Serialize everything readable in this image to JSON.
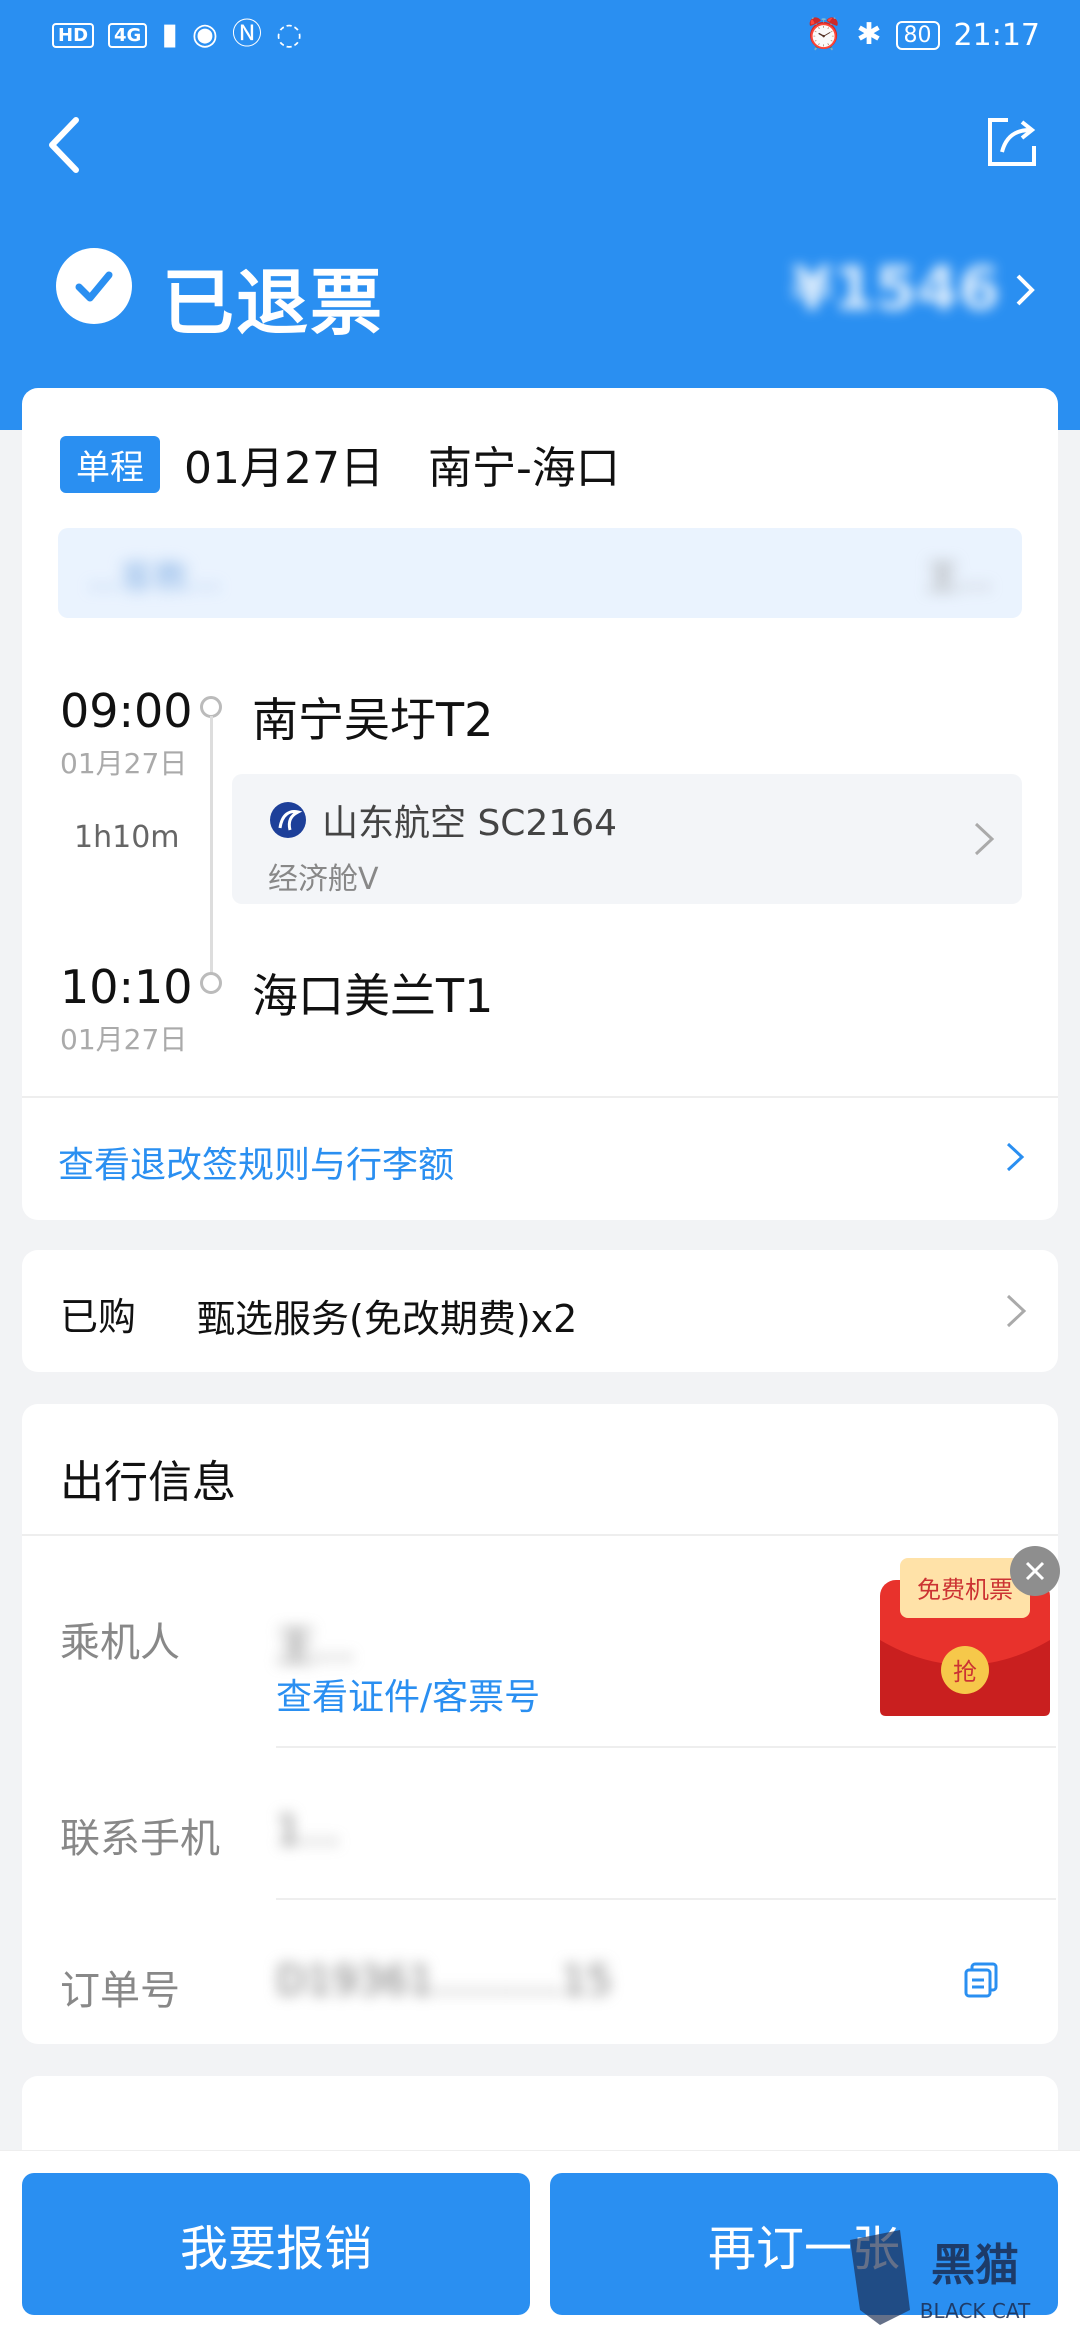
{
  "status_bar": {
    "left_chips": [
      "HD",
      "4G"
    ],
    "right_battery": "80",
    "time": "21:17"
  },
  "header": {
    "status_title": "已退票",
    "price": "¥1546"
  },
  "flight": {
    "tag": "单程",
    "date": "01月27日",
    "route": "南宁-海口",
    "agency_left": "...客教...",
    "agency_right": "王...",
    "depart_time": "09:00",
    "depart_date": "01月27日",
    "depart_airport": "南宁吴圩T2",
    "duration": "1h10m",
    "airline": "山东航空 SC2164",
    "cabin": "经济舱V",
    "arrive_time": "10:10",
    "arrive_date": "01月27日",
    "arrive_airport": "海口美兰T1",
    "rules_link": "查看退改签规则与行李额"
  },
  "service": {
    "label": "已购",
    "text": "甄选服务(免改期费)x2"
  },
  "travel_info": {
    "title": "出行信息",
    "passenger_label": "乘机人",
    "passenger_value": "王...",
    "passenger_link": "查看证件/客票号",
    "phone_label": "联系手机",
    "phone_value": "1...",
    "order_label": "订单号",
    "order_value": "D19361..........15"
  },
  "promo": {
    "text": "免费机票",
    "grab": "抢"
  },
  "buttons": {
    "reimburse": "我要报销",
    "rebook": "再订一张"
  },
  "watermark": {
    "text": "黑猫",
    "sub": "BLACK CAT"
  },
  "colors": {
    "brand_blue": "#2a8ff1",
    "page_bg": "#f2f3f5"
  }
}
